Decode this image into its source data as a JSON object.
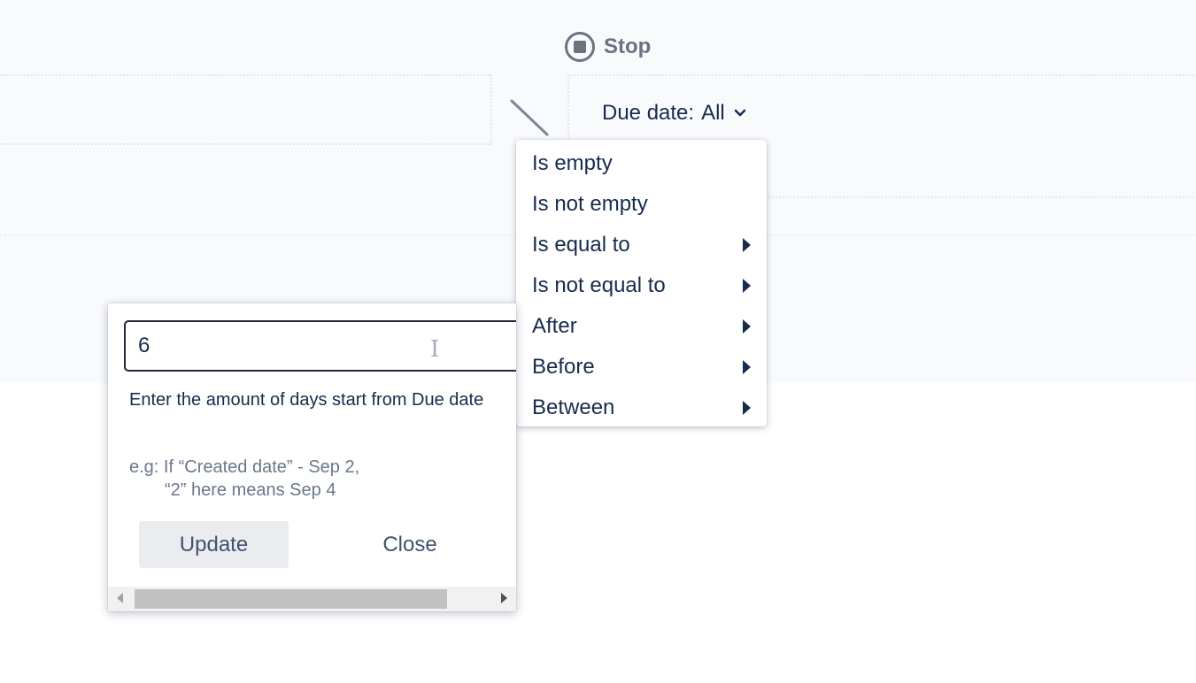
{
  "workflow": {
    "stop_label": "Stop"
  },
  "filter": {
    "label": "Due date:",
    "value": "All"
  },
  "menu": {
    "items": [
      {
        "label": "Is empty",
        "has_submenu": false
      },
      {
        "label": "Is not empty",
        "has_submenu": false
      },
      {
        "label": "Is equal to",
        "has_submenu": true
      },
      {
        "label": "Is not equal to",
        "has_submenu": true
      },
      {
        "label": "After",
        "has_submenu": true
      },
      {
        "label": "Before",
        "has_submenu": true
      },
      {
        "label": "Between",
        "has_submenu": true
      }
    ]
  },
  "popup": {
    "input_value": "6",
    "help_text": "Enter the amount of days start from Due date",
    "example_line1": "e.g: If “Created date” - Sep 2,",
    "example_line2": "“2” here means Sep 4",
    "update_label": "Update",
    "close_label": "Close"
  },
  "colors": {
    "canvas_bg": "#f9fafc",
    "text": "#172b4d",
    "muted": "#6b778c",
    "button_bg": "#ebecf0"
  },
  "icons": [
    "stop-icon",
    "chevron-down-icon",
    "submenu-arrow-icon",
    "text-cursor-icon"
  ]
}
